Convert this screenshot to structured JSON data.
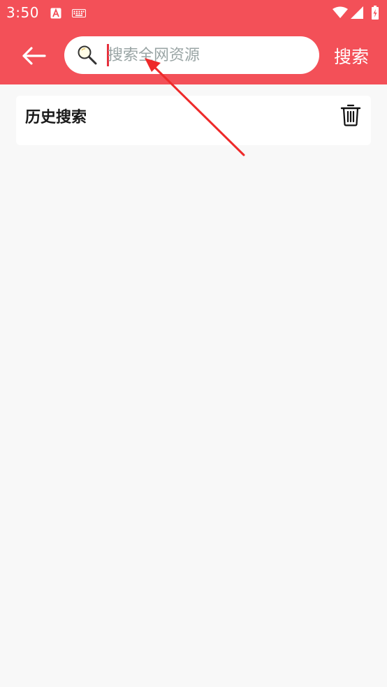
{
  "status_bar": {
    "time": "3:50",
    "icons": [
      "text-a-icon",
      "keyboard-icon",
      "wifi-icon",
      "cellular-signal-icon",
      "battery-charging-icon"
    ]
  },
  "app_bar": {
    "back_icon": "arrow-left-icon",
    "search_icon": "magnifier-icon",
    "search_placeholder": "搜索全网资源",
    "search_value": "",
    "search_button_label": "搜索"
  },
  "history": {
    "title": "历史搜索",
    "clear_icon": "trash-icon"
  },
  "annotation": {
    "type": "arrow",
    "color": "#ee2a2a"
  },
  "colors": {
    "primary": "#f35058",
    "background": "#f8f8f8",
    "card": "#ffffff",
    "placeholder": "#9aa5a5"
  }
}
